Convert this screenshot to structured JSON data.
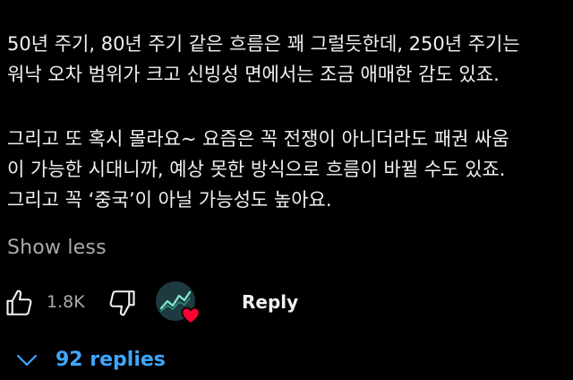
{
  "comment": {
    "paragraph1": [
      "50년 주기, 80년 주기 같은 흐름은 꽤 그럴듯한데, 250년 주기는",
      "워낙 오차 범위가 크고 신빙성 면에서는 조금 애매한 감도 있죠."
    ],
    "paragraph2": [
      "그리고 또 혹시 몰라요~ 요즘은 꼭 전쟁이 아니더라도 패권 싸움",
      "이 가능한 시대니까, 예상 못한 방식으로 흐름이 바뀔 수도 있죠.",
      "그리고 꼭 ‘중국’이 아닐 가능성도 높아요."
    ],
    "show_less_label": "Show less"
  },
  "actions": {
    "like_icon": "thumbs-up-icon",
    "like_count": "1.8K",
    "dislike_icon": "thumbs-down-icon",
    "creator_heart_icon": "heart-icon",
    "reply_label": "Reply"
  },
  "replies": {
    "chevron_icon": "chevron-down-icon",
    "label": "92 replies"
  },
  "colors": {
    "background": "#000000",
    "text": "#f1f1f1",
    "secondary_text": "#aaaaaa",
    "link_blue": "#3ea6ff",
    "heart_red": "#ff0033"
  }
}
